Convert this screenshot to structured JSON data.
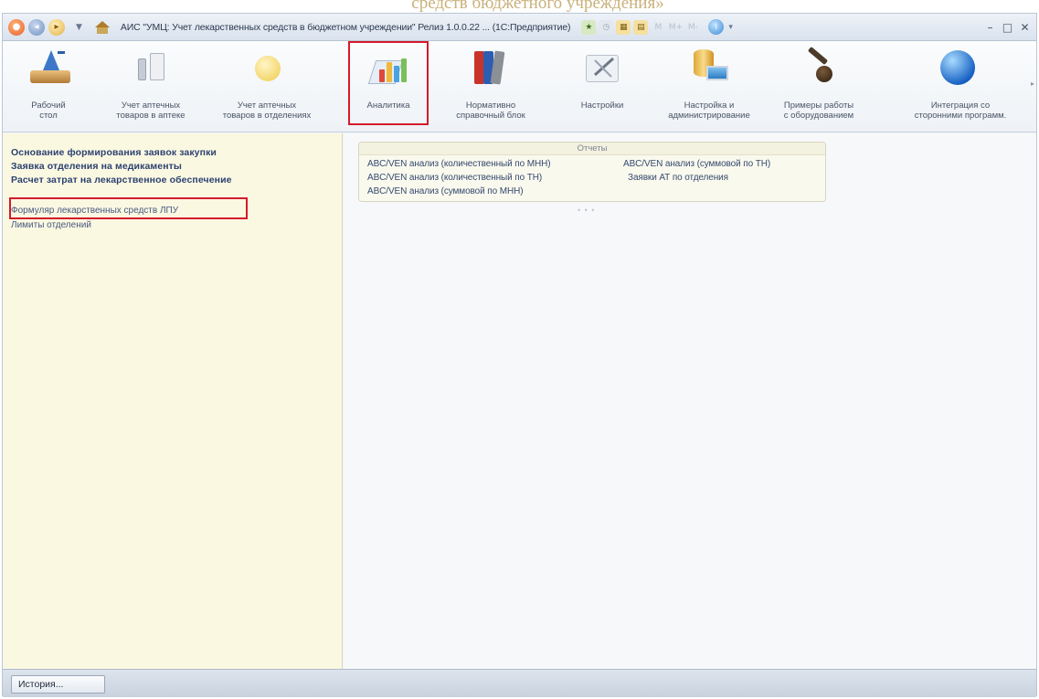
{
  "caption": "средств бюджетного учреждения»",
  "window": {
    "title": "АИС \"УМЦ: Учет лекарственных средств в бюджетном учреждении\" Релиз 1.0.0.22 ... (1С:Предприятие)",
    "controls": {
      "minimize": "–",
      "restore": "□",
      "close": "✕"
    }
  },
  "sections": [
    {
      "id": "workdesk",
      "label_lines": [
        "Рабочий",
        "стол"
      ],
      "icon": "desk-icon"
    },
    {
      "id": "pharmacy",
      "label_lines": [
        "Учет аптечных",
        "товаров в аптеке"
      ],
      "icon": "pharmacy-icon"
    },
    {
      "id": "departments",
      "label_lines": [
        "Учет аптечных",
        "товаров в отделениях"
      ],
      "icon": "pill-icon"
    },
    {
      "id": "analytics",
      "label_lines": [
        "Аналитика"
      ],
      "icon": "analytics-icon",
      "selected": true
    },
    {
      "id": "reference",
      "label_lines": [
        "Нормативно",
        "справочный блок"
      ],
      "icon": "books-icon"
    },
    {
      "id": "settings",
      "label_lines": [
        "Настройки"
      ],
      "icon": "settings-icon"
    },
    {
      "id": "admin",
      "label_lines": [
        "Настройка и",
        "администрирование"
      ],
      "icon": "database-icon"
    },
    {
      "id": "equipment",
      "label_lines": [
        "Примеры работы",
        "с оборудованием"
      ],
      "icon": "scanner-icon"
    },
    {
      "id": "integration",
      "label_lines": [
        "Интеграция со",
        "сторонними программ."
      ],
      "icon": "globe-icon"
    }
  ],
  "navigation": {
    "bold_items": [
      "Основание формирования заявок закупки",
      "Заявка отделения на медикаменты",
      "Расчет затрат на лекарственное обеспечение"
    ],
    "items": [
      "Формуляр лекарственных средств ЛПУ",
      "Лимиты отделений"
    ]
  },
  "reports": {
    "header": "Отчеты",
    "col1": [
      "ABC/VEN анализ (количественный по МНН)",
      "ABC/VEN анализ (количественный по ТН)",
      "ABC/VEN анализ (суммовой по МНН)"
    ],
    "col2": [
      "ABC/VEN анализ (суммовой по ТН)",
      "Заявки АТ по отделения"
    ]
  },
  "bottom": {
    "history_label": "История..."
  }
}
